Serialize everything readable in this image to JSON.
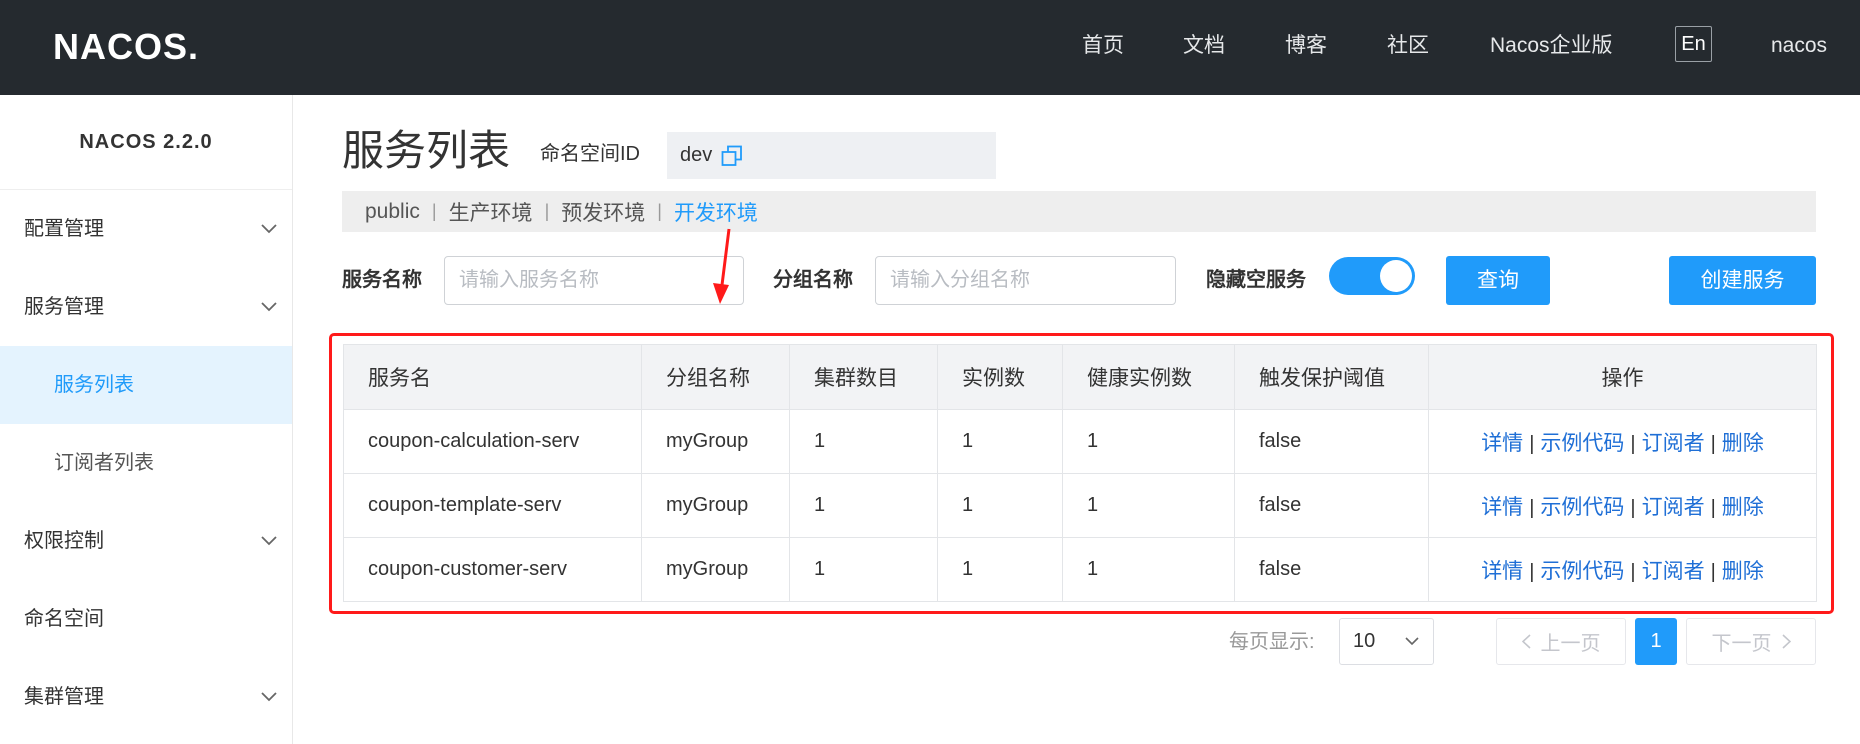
{
  "header": {
    "logo_text": "NACOS.",
    "nav": [
      {
        "label": "首页"
      },
      {
        "label": "文档"
      },
      {
        "label": "博客"
      },
      {
        "label": "社区"
      },
      {
        "label": "Nacos企业版"
      }
    ],
    "lang_toggle": "En",
    "user": "nacos"
  },
  "sidebar": {
    "version": "NACOS 2.2.0",
    "items": [
      {
        "label": "配置管理",
        "icon": "chevron-down-icon"
      },
      {
        "label": "服务管理",
        "icon": "chevron-down-icon"
      },
      {
        "label": "服务列表",
        "selected": true
      },
      {
        "label": "订阅者列表"
      },
      {
        "label": "权限控制",
        "icon": "chevron-down-icon"
      },
      {
        "label": "命名空间"
      },
      {
        "label": "集群管理",
        "icon": "chevron-down-icon"
      }
    ]
  },
  "page": {
    "title": "服务列表",
    "namespace_id_label": "命名空间ID",
    "namespace_id_value": "dev",
    "copy_icon": "copy-icon"
  },
  "namespaces": {
    "separator": "|",
    "items": [
      {
        "label": "public"
      },
      {
        "label": "生产环境"
      },
      {
        "label": "预发环境"
      },
      {
        "label": "开发环境",
        "active": true
      }
    ]
  },
  "filters": {
    "service_name": {
      "label": "服务名称",
      "placeholder": "请输入服务名称"
    },
    "group_name": {
      "label": "分组名称",
      "placeholder": "请输入分组名称"
    },
    "hide_empty": {
      "label": "隐藏空服务",
      "on": true
    },
    "query_button": "查询",
    "create_button": "创建服务"
  },
  "table": {
    "columns": [
      "服务名",
      "分组名称",
      "集群数目",
      "实例数",
      "健康实例数",
      "触发保护阈值",
      "操作"
    ],
    "rows": [
      {
        "name": "coupon-calculation-serv",
        "group": "myGroup",
        "cluster_count": "1",
        "instance_count": "1",
        "healthy_instance_count": "1",
        "protect_threshold": "false"
      },
      {
        "name": "coupon-template-serv",
        "group": "myGroup",
        "cluster_count": "1",
        "instance_count": "1",
        "healthy_instance_count": "1",
        "protect_threshold": "false"
      },
      {
        "name": "coupon-customer-serv",
        "group": "myGroup",
        "cluster_count": "1",
        "instance_count": "1",
        "healthy_instance_count": "1",
        "protect_threshold": "false"
      }
    ],
    "actions": [
      "详情",
      "示例代码",
      "订阅者",
      "删除"
    ],
    "action_separator": "|"
  },
  "pagination": {
    "page_size_label": "每页显示:",
    "page_size": "10",
    "prev_label": "上一页",
    "current_page": "1",
    "next_label": "下一页"
  },
  "colors": {
    "header_bg": "#252a2f",
    "accent": "#209bfa",
    "link": "#1f6fd6",
    "selected_bg": "#e4f3fe",
    "highlight": "#ff1a1a"
  }
}
